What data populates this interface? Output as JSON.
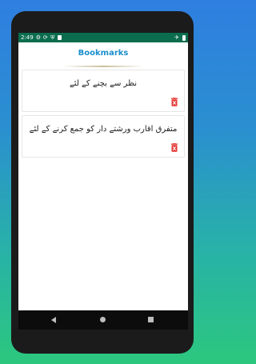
{
  "status_bar": {
    "time": "2:49",
    "icons_left": [
      "gear-icon",
      "sync-icon",
      "shield-icon",
      "sdcard-icon"
    ],
    "icons_right": [
      "airplane-icon",
      "battery-icon"
    ]
  },
  "appbar": {
    "title": "Bookmarks"
  },
  "bookmarks": [
    {
      "text": "نظر سے بچنے کے لئے"
    },
    {
      "text": "متفرق اقارب ورشتے دار کو جمع کرنے کے لئے"
    }
  ],
  "colors": {
    "status_bar": "#0b6d4e",
    "title": "#1c8fcd",
    "delete_icon": "#e53935",
    "gradient_top": "#2f7fe0",
    "gradient_bottom": "#2cc77e"
  },
  "navigation": [
    "back-icon",
    "home-icon",
    "recent-apps-icon"
  ]
}
